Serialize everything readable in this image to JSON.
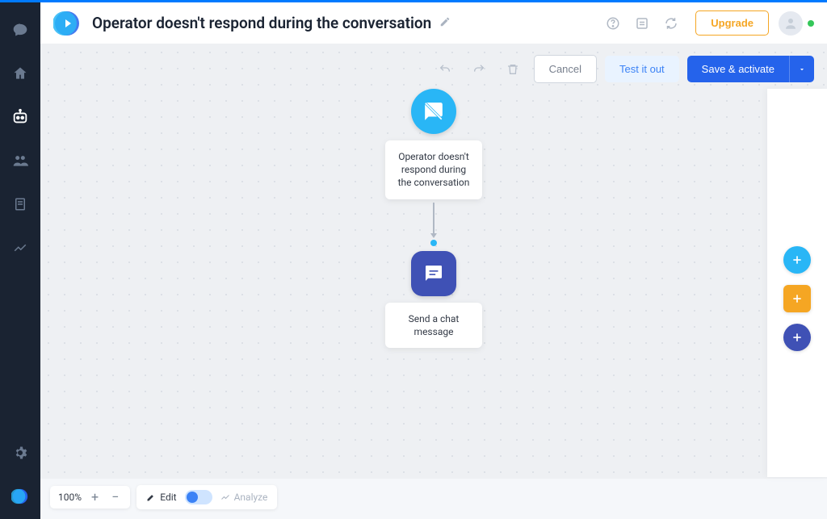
{
  "header": {
    "title": "Operator doesn't respond during the conversation",
    "upgrade_label": "Upgrade"
  },
  "toolbar": {
    "cancel_label": "Cancel",
    "test_label": "Test it out",
    "save_label": "Save & activate"
  },
  "flow": {
    "trigger": {
      "label": "Operator doesn't respond during the conversation"
    },
    "action": {
      "label": "Send a chat message"
    }
  },
  "zoom": {
    "level": "100%",
    "edit_label": "Edit",
    "analyze_label": "Analyze"
  },
  "icons": {
    "chat": "chat-icon",
    "home": "home-icon",
    "bot": "bot-icon",
    "people": "people-icon",
    "doc": "doc-icon",
    "analytics": "analytics-icon",
    "gear": "gear-icon",
    "orb": "orb-icon",
    "help": "help-icon",
    "activity": "activity-icon",
    "sync": "sync-icon",
    "pencil": "pencil-icon",
    "undo": "undo-icon",
    "redo": "redo-icon",
    "trash": "trash-icon",
    "chevron_down": "chevron-down-icon",
    "plus": "plus-icon"
  },
  "colors": {
    "accent_blue": "#2563eb",
    "trigger_cyan": "#29b6f6",
    "action_indigo": "#3f51b5",
    "amber": "#f5a623"
  }
}
